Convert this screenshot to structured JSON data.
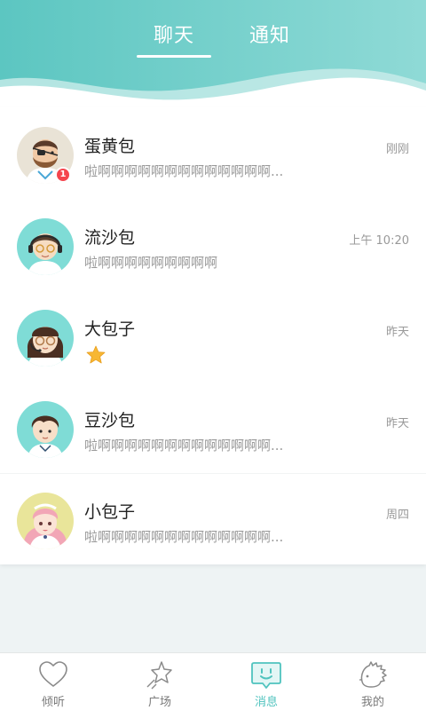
{
  "header": {
    "tabs": [
      {
        "label": "聊天",
        "active": true
      },
      {
        "label": "通知",
        "active": false
      }
    ],
    "gradient_start": "#5cc6c1",
    "gradient_end": "#8fdad6"
  },
  "conversations": [
    {
      "name": "蛋黄包",
      "time": "刚刚",
      "preview": "啦啊啊啊啊啊啊啊啊啊啊啊啊啊...",
      "unread": "1",
      "avatar": "bearded-man-eyepatch-avatar"
    },
    {
      "name": "流沙包",
      "time": "上午 10:20",
      "preview": "啦啊啊啊啊啊啊啊啊啊",
      "avatar": "girl-headset-glasses-avatar"
    },
    {
      "name": "大包子",
      "time": "昨天",
      "preview_icon": "star-emoji",
      "avatar": "girl-bangs-glasses-avatar"
    },
    {
      "name": "豆沙包",
      "time": "昨天",
      "preview": "啦啊啊啊啊啊啊啊啊啊啊啊啊啊...",
      "avatar": "boy-sailor-avatar"
    },
    {
      "name": "小包子",
      "time": "周四",
      "preview": "啦啊啊啊啊啊啊啊啊啊啊啊啊啊...",
      "avatar": "pink-hair-maid-girl-avatar"
    }
  ],
  "bottom_nav": [
    {
      "label": "倾听",
      "icon": "heart-icon",
      "active": false
    },
    {
      "label": "广场",
      "icon": "star-icon",
      "active": false
    },
    {
      "label": "消息",
      "icon": "message-icon",
      "active": true
    },
    {
      "label": "我的",
      "icon": "hedgehog-icon",
      "active": false
    }
  ],
  "colors": {
    "accent": "#4fc3be",
    "badge": "#f5454d",
    "star": "#f7b733"
  }
}
